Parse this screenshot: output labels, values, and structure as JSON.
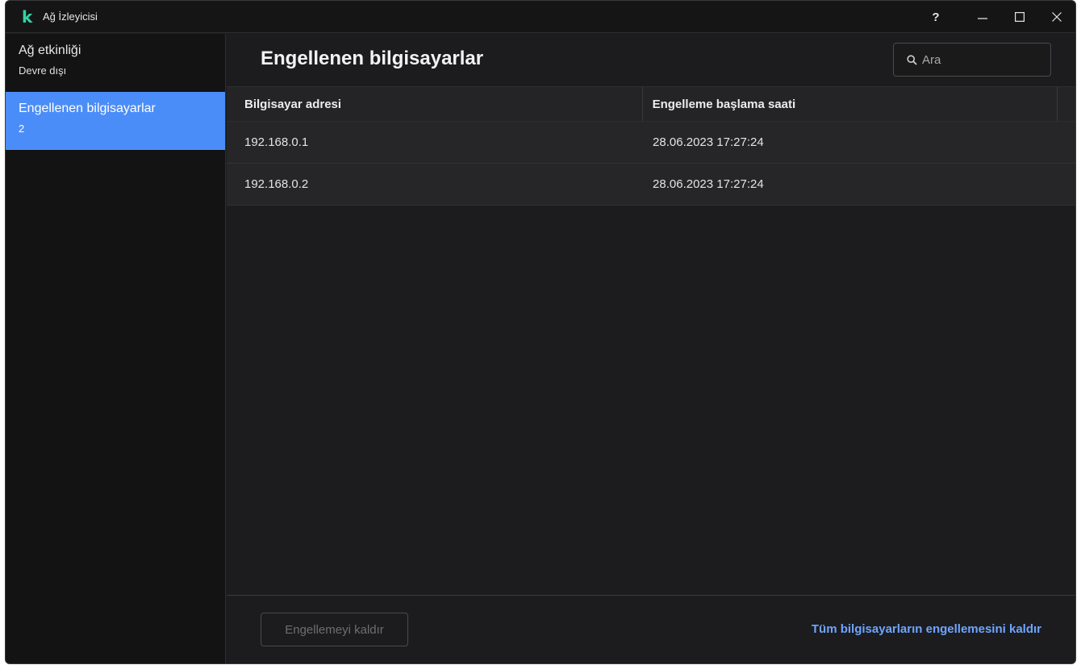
{
  "window": {
    "title": "Ağ İzleyicisi",
    "logo_letter": "k",
    "controls": {
      "help": "?"
    }
  },
  "sidebar": {
    "items": [
      {
        "label": "Ağ etkinliği",
        "sub": "Devre dışı",
        "active": false
      },
      {
        "label": "Engellenen bilgisayarlar",
        "sub": "2",
        "active": true
      }
    ]
  },
  "main": {
    "title": "Engellenen bilgisayarlar",
    "search": {
      "placeholder": "Ara",
      "value": ""
    },
    "table": {
      "columns": [
        "Bilgisayar adresi",
        "Engelleme başlama saati"
      ],
      "rows": [
        [
          "192.168.0.1",
          "28.06.2023 17:27:24"
        ],
        [
          "192.168.0.2",
          "28.06.2023 17:27:24"
        ]
      ]
    },
    "footer": {
      "unblock_button": "Engellemeyi kaldır",
      "unblock_all_link": "Tüm bilgisayarların engellemesini kaldır"
    }
  },
  "colors": {
    "accent": "#4b8df8",
    "logo": "#2fd4a5",
    "link": "#6fa5ff",
    "background": "#1c1c1e"
  }
}
